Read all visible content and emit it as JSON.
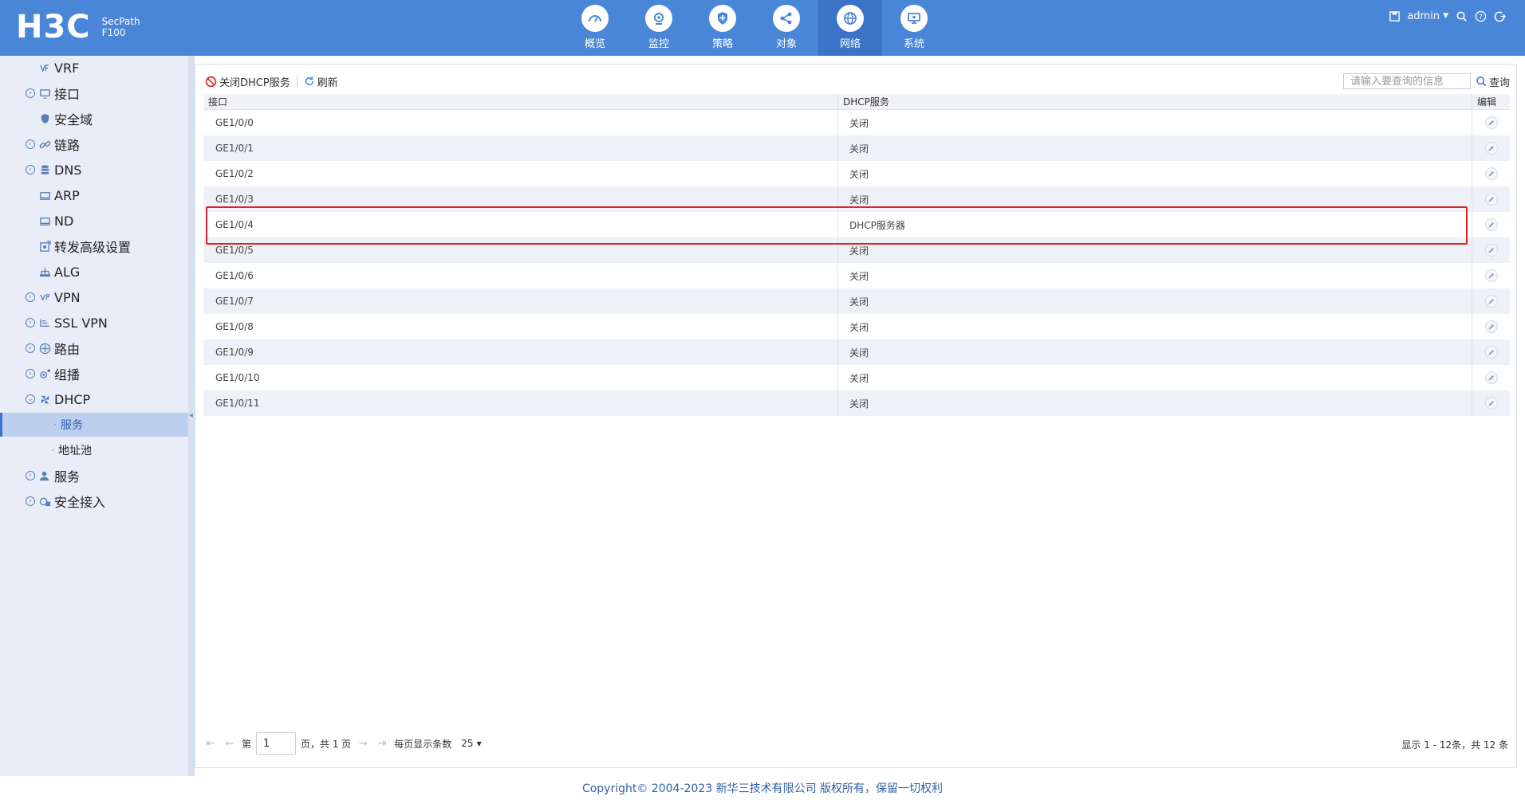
{
  "header": {
    "logo_text": "H3C",
    "product_line1": "SecPath",
    "product_line2": "F100",
    "nav": [
      {
        "label": "概览",
        "icon": "dashboard-icon"
      },
      {
        "label": "监控",
        "icon": "monitor-icon"
      },
      {
        "label": "策略",
        "icon": "shield-icon"
      },
      {
        "label": "对象",
        "icon": "share-icon"
      },
      {
        "label": "网络",
        "icon": "globe-icon",
        "active": true
      },
      {
        "label": "系统",
        "icon": "system-icon"
      }
    ],
    "user": "admin"
  },
  "sidebar": {
    "items": [
      {
        "label": "VRF",
        "icon": "vrf-icon",
        "expandable": false
      },
      {
        "label": "接口",
        "icon": "interface-icon",
        "expandable": true
      },
      {
        "label": "安全域",
        "icon": "security-zone-icon",
        "expandable": false
      },
      {
        "label": "链路",
        "icon": "link-icon",
        "expandable": true
      },
      {
        "label": "DNS",
        "icon": "dns-icon",
        "expandable": true
      },
      {
        "label": "ARP",
        "icon": "arp-icon",
        "expandable": false
      },
      {
        "label": "ND",
        "icon": "nd-icon",
        "expandable": false
      },
      {
        "label": "转发高级设置",
        "icon": "forward-settings-icon",
        "expandable": false
      },
      {
        "label": "ALG",
        "icon": "alg-icon",
        "expandable": false
      },
      {
        "label": "VPN",
        "icon": "vpn-icon",
        "expandable": true
      },
      {
        "label": "SSL VPN",
        "icon": "ssl-vpn-icon",
        "expandable": true
      },
      {
        "label": "路由",
        "icon": "route-icon",
        "expandable": true
      },
      {
        "label": "组播",
        "icon": "multicast-icon",
        "expandable": true
      },
      {
        "label": "DHCP",
        "icon": "dhcp-icon",
        "expandable": true
      },
      {
        "label": "服务",
        "sub": true,
        "selected": true
      },
      {
        "label": "地址池",
        "sub": true
      },
      {
        "label": "服务",
        "icon": "service-icon",
        "expandable": true
      },
      {
        "label": "安全接入",
        "icon": "secure-access-icon",
        "expandable": true
      }
    ]
  },
  "toolbar": {
    "close_dhcp_label": "关闭DHCP服务",
    "refresh_label": "刷新",
    "search_placeholder": "请输入要查询的信息",
    "search_label": "查询"
  },
  "table": {
    "columns": [
      "接口",
      "DHCP服务",
      "编辑"
    ],
    "rows": [
      {
        "interface": "GE1/0/0",
        "dhcp": "关闭"
      },
      {
        "interface": "GE1/0/1",
        "dhcp": "关闭"
      },
      {
        "interface": "GE1/0/2",
        "dhcp": "关闭"
      },
      {
        "interface": "GE1/0/3",
        "dhcp": "关闭"
      },
      {
        "interface": "GE1/0/4",
        "dhcp": "DHCP服务器",
        "highlighted": true
      },
      {
        "interface": "GE1/0/5",
        "dhcp": "关闭"
      },
      {
        "interface": "GE1/0/6",
        "dhcp": "关闭"
      },
      {
        "interface": "GE1/0/7",
        "dhcp": "关闭"
      },
      {
        "interface": "GE1/0/8",
        "dhcp": "关闭"
      },
      {
        "interface": "GE1/0/9",
        "dhcp": "关闭"
      },
      {
        "interface": "GE1/0/10",
        "dhcp": "关闭"
      },
      {
        "interface": "GE1/0/11",
        "dhcp": "关闭"
      }
    ]
  },
  "pager": {
    "page_prefix": "第",
    "page_value": "1",
    "page_suffix": "页，共 1 页",
    "per_page_label": "每页显示条数",
    "per_page_value": "25",
    "summary": "显示 1 - 12条，共 12 条"
  },
  "footer": {
    "copyright": "Copyright© 2004-2023 新华三技术有限公司 版权所有，保留一切权利"
  },
  "colors": {
    "header_bg": "#4a86d8",
    "nav_active_bg": "#3b74c7",
    "sidebar_bg": "#e8edf7",
    "selected_bg": "#bcd0ee",
    "highlight_border": "#e22020",
    "footer_text": "#2f5ea8"
  }
}
